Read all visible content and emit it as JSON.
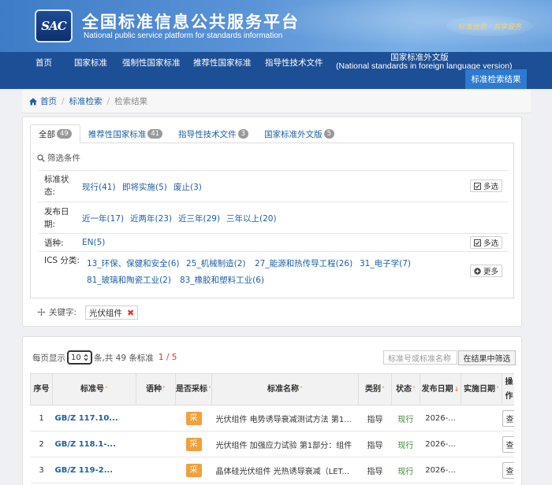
{
  "header": {
    "logo": "SAC",
    "title": "全国标准信息公共服务平台",
    "subtitle": "National public service platform  for standards information",
    "slogan": "标准信息 · 共享服务"
  },
  "nav": {
    "items": [
      "首页",
      "国家标准",
      "强制性国家标准",
      "推荐性国家标准",
      "指导性技术文件"
    ],
    "foreign_line1": "国家标准外文版",
    "foreign_line2": "(National standards in foreign language version)",
    "active": "标准检索结果"
  },
  "breadcrumb": [
    "首页",
    "标准检索",
    "检索结果"
  ],
  "tabs": [
    {
      "label": "全部",
      "count": "49"
    },
    {
      "label": "推荐性国家标准",
      "count": "41"
    },
    {
      "label": "指导性技术文件",
      "count": "3"
    },
    {
      "label": "国家标准外文版",
      "count": "5"
    }
  ],
  "filter": {
    "title": "筛选条件",
    "status_label_1": "标准状",
    "status_label_2": "态:",
    "status_opts": [
      "现行(41)",
      "即将实施(5)",
      "废止(3)"
    ],
    "date_label_1": "发布日",
    "date_label_2": "期:",
    "date_opts": [
      "近一年(17)",
      "近两年(23)",
      "近三年(29)",
      "三年以上(20)"
    ],
    "lang_label": "语种:",
    "lang_opts": [
      "EN(5)"
    ],
    "ics_label": "ICS 分类:",
    "ics_row1": [
      "13_环保、保健和安全(6)",
      "25_机械制造(2)",
      "27_能源和热传导工程(26)",
      "31_电子学(7)"
    ],
    "ics_row2": [
      "81_玻璃和陶瓷工业(2)",
      "83_橡胶和塑料工业(6)"
    ],
    "multi": "多选",
    "more": "更多"
  },
  "keyword": {
    "label": "关键字:",
    "value": "光伏组件"
  },
  "results": {
    "per_page_prefix": "每页显示",
    "per_page_value": "10",
    "total_text": "条,共 49 条标准",
    "page": "1 / 5",
    "search_placeholder": "标准号或标准名称",
    "search_button": "在结果中筛选",
    "columns": [
      "序号",
      "标准号",
      "语种",
      "是否采标",
      "标准名称",
      "类别",
      "状态",
      "发布日期",
      "实施日期",
      "操作"
    ],
    "rows": [
      {
        "idx": "1",
        "code": "GB/Z 117.10...",
        "lang": "",
        "adopt": "采",
        "name": "光伏组件 电势诱导衰减测试方法 第1...",
        "type": "指导",
        "status": "现行",
        "pub": "2026-...",
        "impl": "",
        "action": "查看详细"
      },
      {
        "idx": "2",
        "code": "GB/Z 118.1-...",
        "lang": "",
        "adopt": "采",
        "name": "光伏组件 加强应力试验 第1部分：组件",
        "type": "指导",
        "status": "现行",
        "pub": "2026-...",
        "impl": "",
        "action": "查看详细"
      },
      {
        "idx": "3",
        "code": "GB/Z 119-2...",
        "lang": "",
        "adopt": "采",
        "name": "晶体硅光伏组件 光热诱导衰减（LET...",
        "type": "指导",
        "status": "现行",
        "pub": "2026-...",
        "impl": "",
        "action": "查看详细"
      }
    ]
  }
}
